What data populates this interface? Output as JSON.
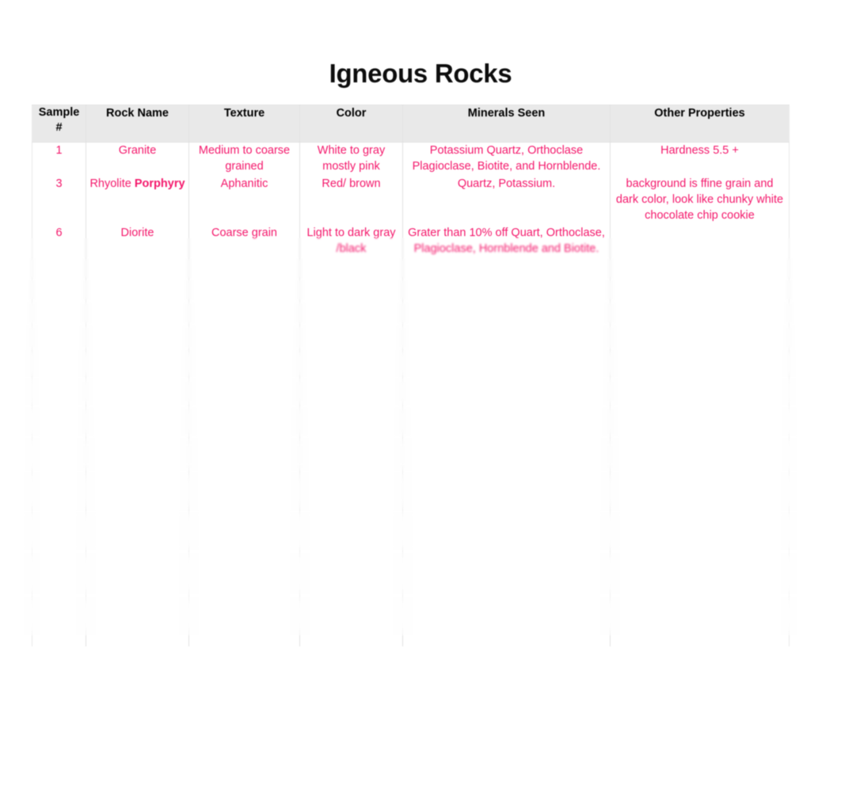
{
  "document": {
    "title": "Igneous Rocks",
    "accent_text_color": "#f4176b",
    "header_background_color": "#e9e9e9",
    "page_background_color": "#ffffff"
  },
  "table": {
    "columns": [
      {
        "key": "sample",
        "label": "Sample #"
      },
      {
        "key": "rock",
        "label": "Rock Name"
      },
      {
        "key": "texture",
        "label": "Texture"
      },
      {
        "key": "color",
        "label": "Color"
      },
      {
        "key": "minerals",
        "label": "Minerals Seen"
      },
      {
        "key": "other",
        "label": "Other Properties"
      }
    ],
    "rows": [
      {
        "sample": "1",
        "rock": "Granite",
        "texture": "Medium to coarse grained",
        "color": "White to gray mostly pink",
        "minerals": "Potassium Quartz, Orthoclase Plagioclase, Biotite, and Hornblende.",
        "other": "Hardness 5.5 +"
      },
      {
        "sample": "3",
        "rock": "Rhyolite ",
        "rock_emphasis": "Porphyry",
        "texture": "Aphanitic",
        "color": "Red/ brown",
        "minerals": "Quartz, Potassium.",
        "other": "background is ffine grain and dark color, look like chunky white chocolate chip cookie"
      },
      {
        "sample": "6",
        "rock": "Diorite",
        "texture": "Coarse grain",
        "color": "Light to dark gray /black",
        "minerals": "Grater than 10% off Quart, Orthoclase, Plagioclase, Hornblende and Biotite.",
        "other": ""
      },
      {
        "sample": "",
        "rock": "",
        "texture": "",
        "color": "",
        "minerals": "",
        "other": ""
      },
      {
        "sample": "",
        "rock": "",
        "texture": "",
        "color": "",
        "minerals": "",
        "other": ""
      },
      {
        "sample": "",
        "rock": "",
        "texture": "",
        "color": "",
        "minerals": "",
        "other": ""
      },
      {
        "sample": "",
        "rock": "",
        "texture": "",
        "color": "",
        "minerals": "",
        "other": ""
      },
      {
        "sample": "",
        "rock": "",
        "texture": "",
        "color": "",
        "minerals": "",
        "other": ""
      },
      {
        "sample": "",
        "rock": "",
        "texture": "",
        "color": "",
        "minerals": "",
        "other": ""
      },
      {
        "sample": "",
        "rock": "",
        "texture": "",
        "color": "",
        "minerals": "",
        "other": ""
      },
      {
        "sample": "",
        "rock": "",
        "texture": "",
        "color": "",
        "minerals": "",
        "other": ""
      },
      {
        "sample": "",
        "rock": "",
        "texture": "",
        "color": "",
        "minerals": "",
        "other": ""
      },
      {
        "sample": "",
        "rock": "",
        "texture": "",
        "color": "",
        "minerals": "",
        "other": ""
      },
      {
        "sample": "",
        "rock": "",
        "texture": "",
        "color": "",
        "minerals": "",
        "other": ""
      }
    ]
  }
}
